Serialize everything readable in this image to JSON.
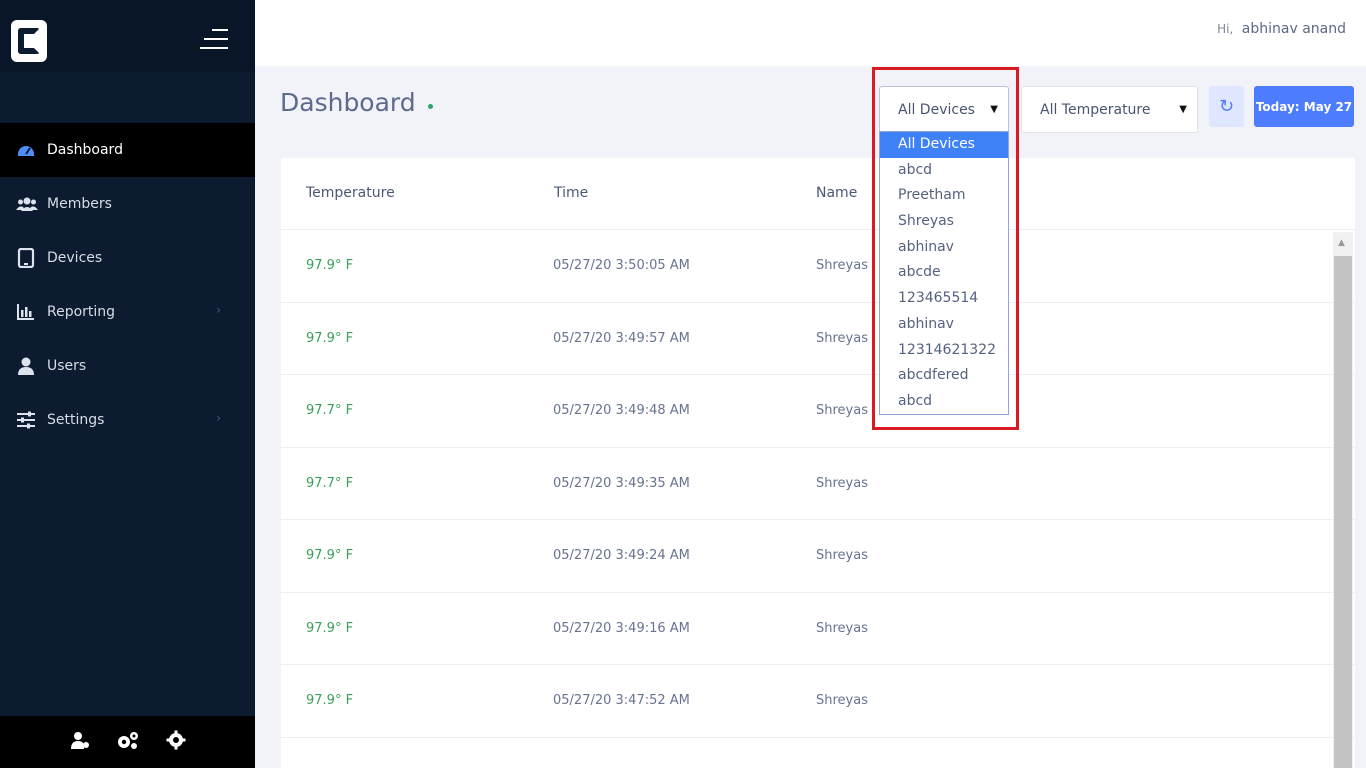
{
  "header": {
    "greeting_prefix": "Hi,",
    "user_name": "abhinav anand"
  },
  "sidebar": {
    "items": [
      {
        "label": "Dashboard",
        "icon": "dashboard-icon",
        "active": true
      },
      {
        "label": "Members",
        "icon": "members-icon"
      },
      {
        "label": "Devices",
        "icon": "tablet-icon"
      },
      {
        "label": "Reporting",
        "icon": "bar-chart-icon",
        "has_submenu": true
      },
      {
        "label": "Users",
        "icon": "user-icon"
      },
      {
        "label": "Settings",
        "icon": "sliders-icon",
        "has_submenu": true
      }
    ],
    "footer_icons": [
      "user-cog-icon",
      "cogs-icon",
      "gear-icon"
    ]
  },
  "page": {
    "title": "Dashboard"
  },
  "filters": {
    "devices_selected": "All Devices",
    "temperature_selected": "All Temperature",
    "today_label": "Today: May 27",
    "devices_options": [
      "All Devices",
      "abcd",
      "Preetham",
      "Shreyas",
      "abhinav",
      "abcde",
      "123465514",
      "abhinav",
      "12314621322",
      "abcdfered",
      "abcd"
    ]
  },
  "table": {
    "headers": {
      "temperature": "Temperature",
      "time": "Time",
      "name": "Name"
    },
    "rows": [
      {
        "temp": "97.9° F",
        "time": "05/27/20 3:50:05 AM",
        "name": "Shreyas"
      },
      {
        "temp": "97.9° F",
        "time": "05/27/20 3:49:57 AM",
        "name": "Shreyas"
      },
      {
        "temp": "97.7° F",
        "time": "05/27/20 3:49:48 AM",
        "name": "Shreyas"
      },
      {
        "temp": "97.7° F",
        "time": "05/27/20 3:49:35 AM",
        "name": "Shreyas"
      },
      {
        "temp": "97.9° F",
        "time": "05/27/20 3:49:24 AM",
        "name": "Shreyas"
      },
      {
        "temp": "97.9° F",
        "time": "05/27/20 3:49:16 AM",
        "name": "Shreyas"
      },
      {
        "temp": "97.9° F",
        "time": "05/27/20 3:47:52 AM",
        "name": "Shreyas"
      }
    ]
  },
  "colors": {
    "sidebar": "#0c1b30",
    "accent": "#4d7cfe",
    "temp_text": "#3aa15a",
    "highlight": "#d81a21"
  }
}
